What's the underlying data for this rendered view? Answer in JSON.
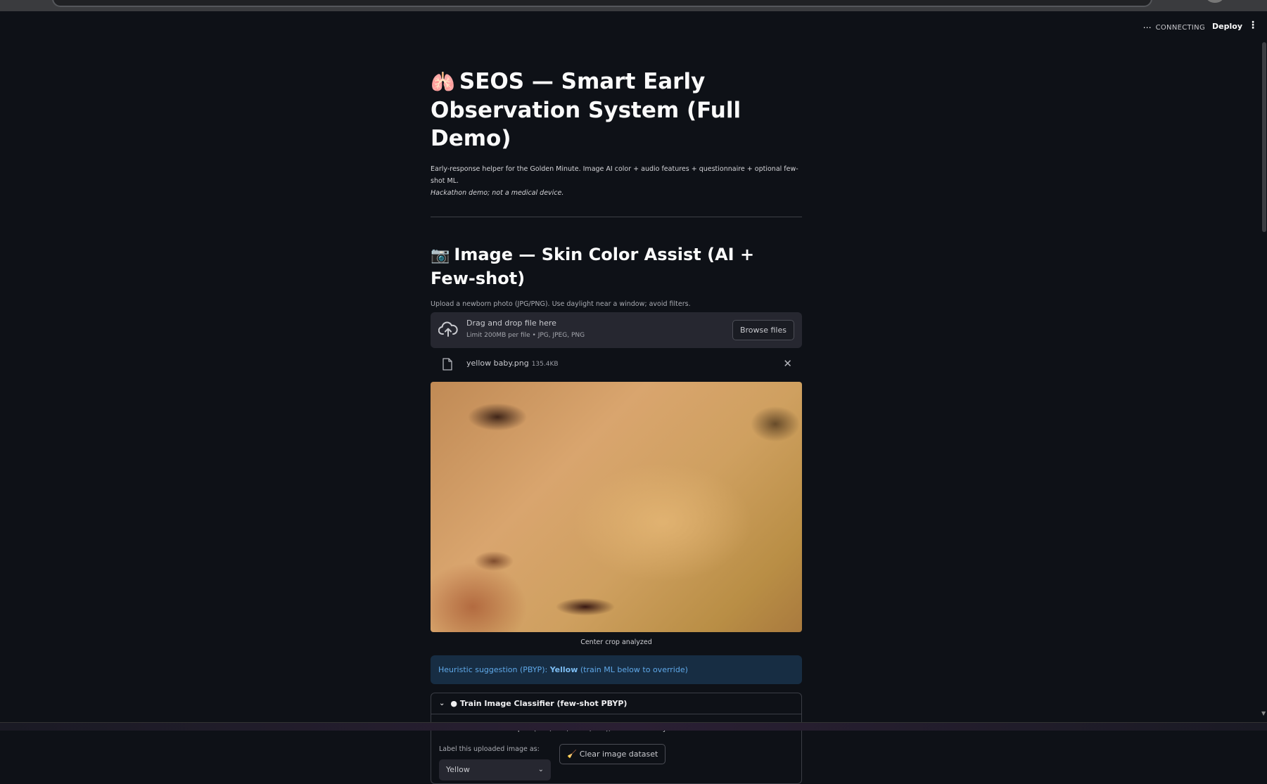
{
  "header": {
    "status_dots": "⋯",
    "status_label": "CONNECTING",
    "deploy_label": "Deploy",
    "menu_icon": "⋮"
  },
  "main": {
    "title_emoji": "🫁",
    "title": "SEOS — Smart Early Observation System (Full Demo)",
    "subtitle_line1": "Early-response helper for the Golden Minute. Image AI color + audio features + questionnaire + optional few-shot ML.",
    "subtitle_line2": "Hackathon demo; not a medical device.",
    "section_emoji": "📷",
    "section_title": "Image — Skin Color Assist (AI + Few-shot)",
    "upload_hint": "Upload a newborn photo (JPG/PNG). Use daylight near a window; avoid filters."
  },
  "uploader": {
    "drop_title": "Drag and drop file here",
    "limit_text": "Limit 200MB per file • JPG, JPEG, PNG",
    "browse_label": "Browse files",
    "file_name": "yellow baby.png",
    "file_size": "135.4KB",
    "remove_icon": "✕"
  },
  "image": {
    "caption": "Center crop analyzed"
  },
  "suggestion": {
    "prefix": "Heuristic suggestion (PBYP): ",
    "value": "Yellow",
    "suffix": " (train ML below to override)"
  },
  "expander": {
    "chevron": "⌄",
    "title": "● Train Image Classifier (few-shot PBYP)",
    "description": "Add labeled PBYP examples (Pink/Blue/Yellow/Pale), then train a tiny model.",
    "label_prompt": "Label this uploaded image as:",
    "selected_label": "Yellow",
    "select_arrow": "⌄",
    "broom_icon": "🧹",
    "clear_label": "Clear image dataset"
  }
}
